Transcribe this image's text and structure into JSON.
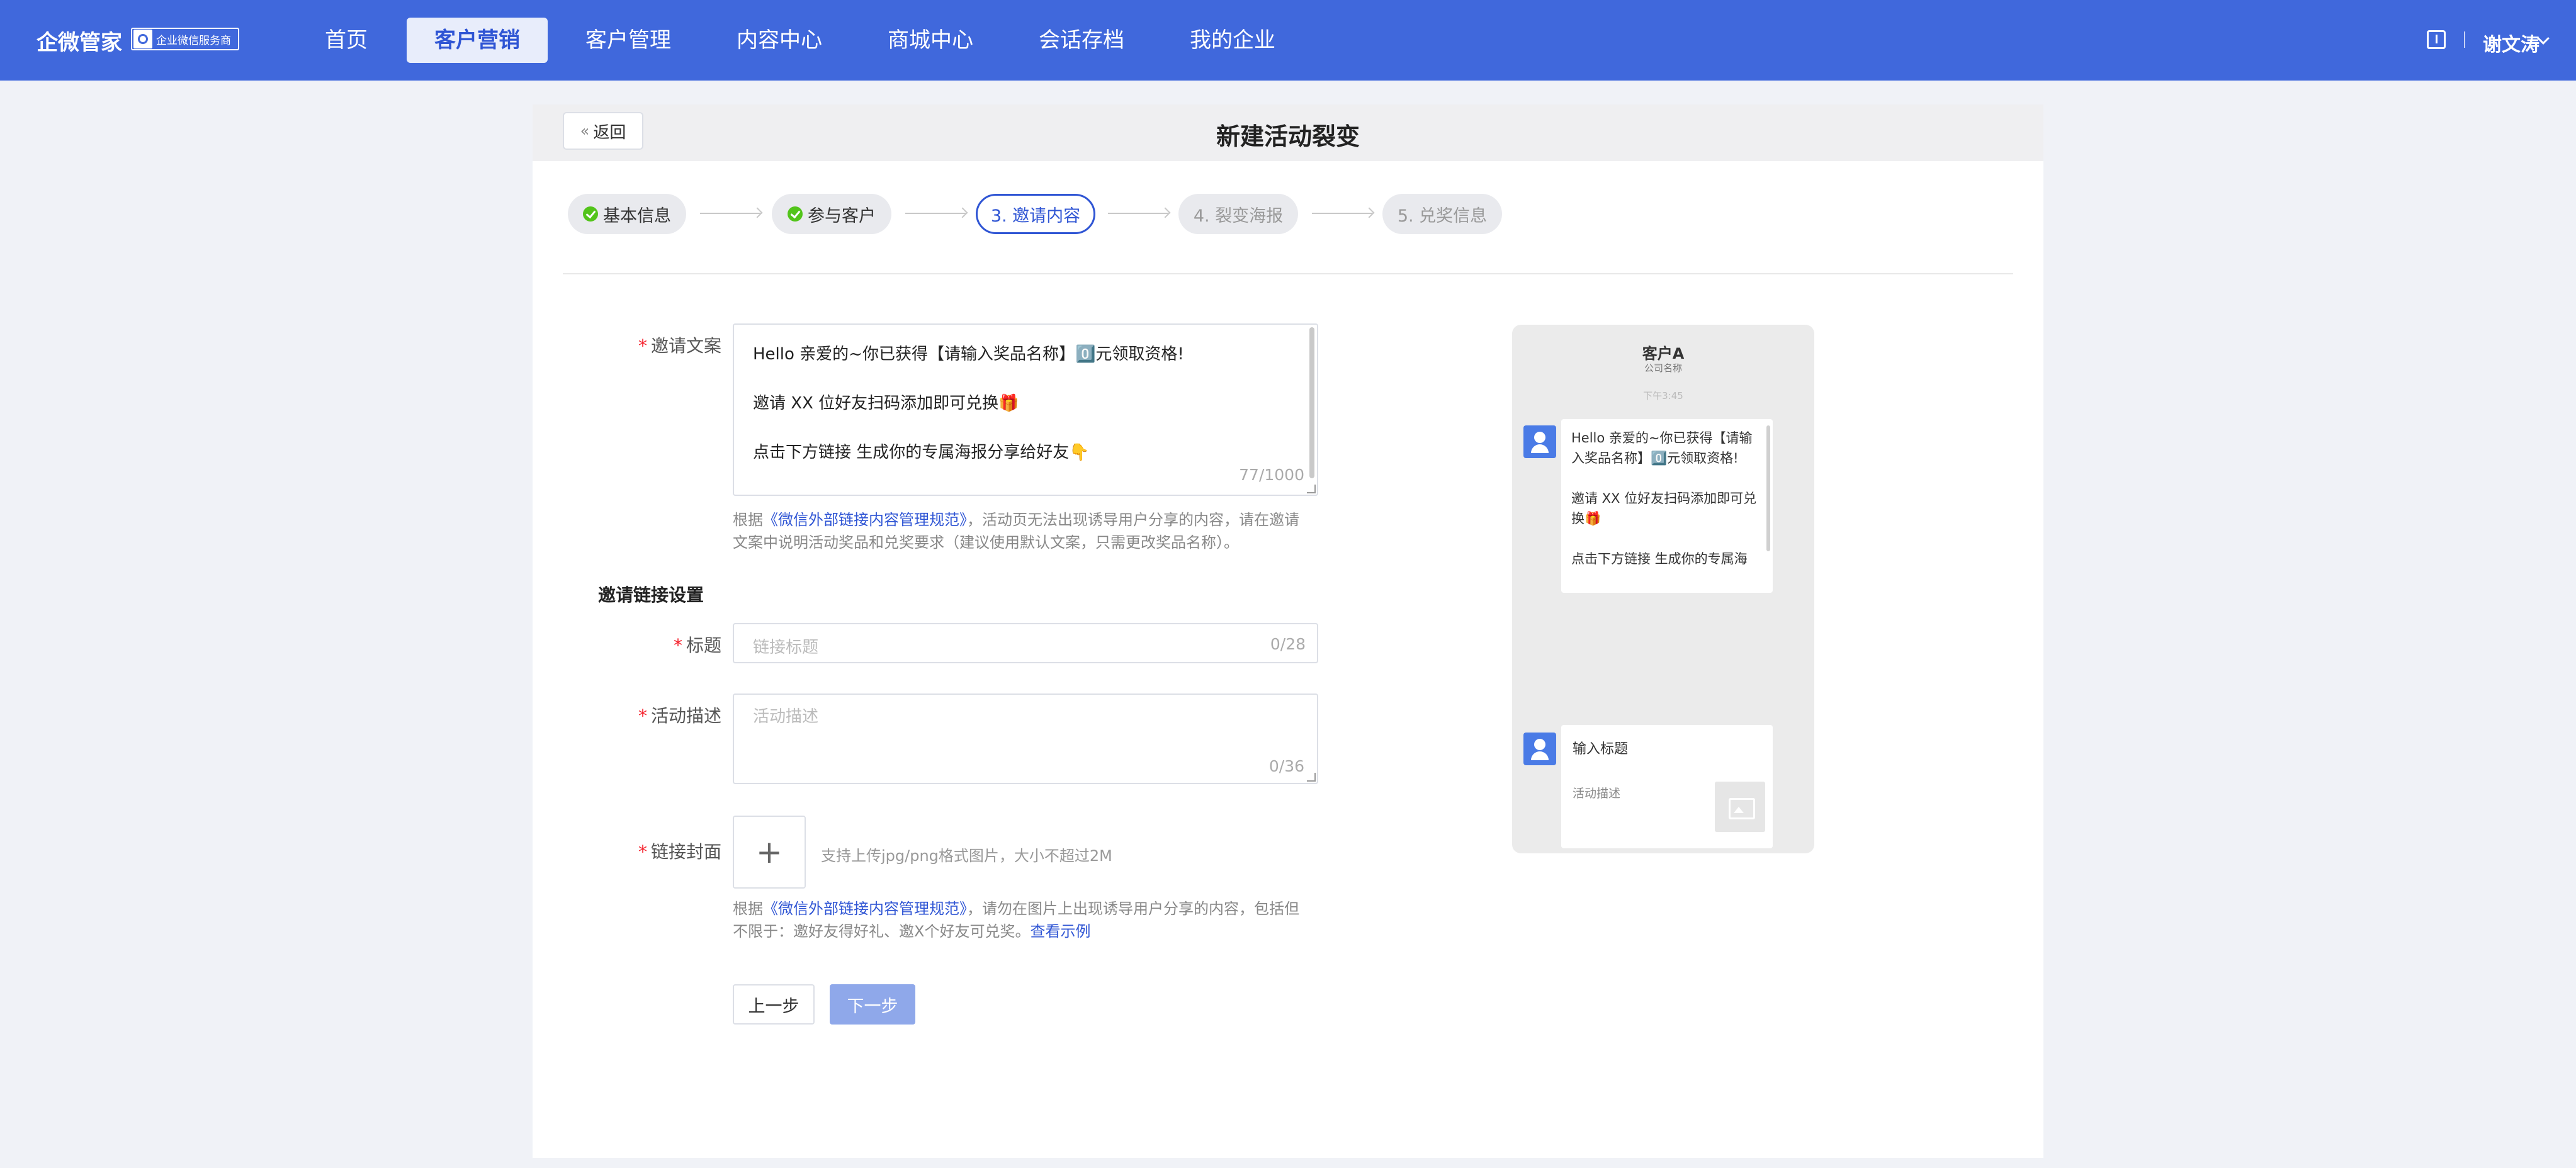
{
  "nav": {
    "brand": "企微管家",
    "badge": "企业微信服务商",
    "items": [
      "首页",
      "客户营销",
      "客户管理",
      "内容中心",
      "商城中心",
      "会话存档",
      "我的企业"
    ],
    "active_index": 1,
    "user": "谢文涛"
  },
  "header": {
    "back_label": "返回",
    "title": "新建活动裂变"
  },
  "steps": [
    {
      "label": "基本信息",
      "state": "done"
    },
    {
      "label": "参与客户",
      "state": "done"
    },
    {
      "label": "3. 邀请内容",
      "state": "current"
    },
    {
      "label": "4. 裂变海报",
      "state": "pending"
    },
    {
      "label": "5. 兑奖信息",
      "state": "pending"
    }
  ],
  "form": {
    "invite_text_label": "邀请文案",
    "invite_text_lines": [
      "Hello 亲爱的~你已获得【请输入奖品名称】0️⃣元领取资格!",
      "邀请 XX 位好友扫码添加即可兑换🎁",
      "点击下方链接 生成你的专属海报分享给好友👇"
    ],
    "invite_text_count": "77/1000",
    "invite_hint_prefix": "根据",
    "invite_hint_link": "《微信外部链接内容管理规范》",
    "invite_hint_line1": "，活动页无法出现诱导用户分享的内容，请在邀请",
    "invite_hint_line2": "文案中说明活动奖品和兑奖要求（建议使用默认文案，只需更改奖品名称）。",
    "section_title": "邀请链接设置",
    "title_label": "标题",
    "title_placeholder": "链接标题",
    "title_count": "0/28",
    "desc_label": "活动描述",
    "desc_placeholder": "活动描述",
    "desc_count": "0/36",
    "cover_label": "链接封面",
    "upload_plus": "+",
    "upload_hint": "支持上传jpg/png格式图片，大小不超过2M",
    "cover_hint_prefix": "根据",
    "cover_hint_link": "《微信外部链接内容管理规范》",
    "cover_hint_line1": "，请勿在图片上出现诱导用户分享的内容，包括但",
    "cover_hint_line2": "不限于：邀好友得好礼、邀X个好友可兑奖。",
    "cover_hint_example": "查看示例",
    "prev_button": "上一步",
    "next_button": "下一步"
  },
  "preview": {
    "contact_name": "客户A",
    "company": "公司名称",
    "time": "下午3:45",
    "bubble_lines": [
      "Hello 亲爱的~你已获得【请输入奖品名称】0️⃣元领取资格!",
      "邀请 XX 位好友扫码添加即可兑换🎁",
      "点击下方链接 生成你的专属海"
    ],
    "link_title": "输入标题",
    "link_desc": "活动描述"
  },
  "colors": {
    "nav_bg": "#4068dc",
    "primary": "#2f55d4",
    "required": "#f5222d",
    "success": "#52c41a"
  }
}
